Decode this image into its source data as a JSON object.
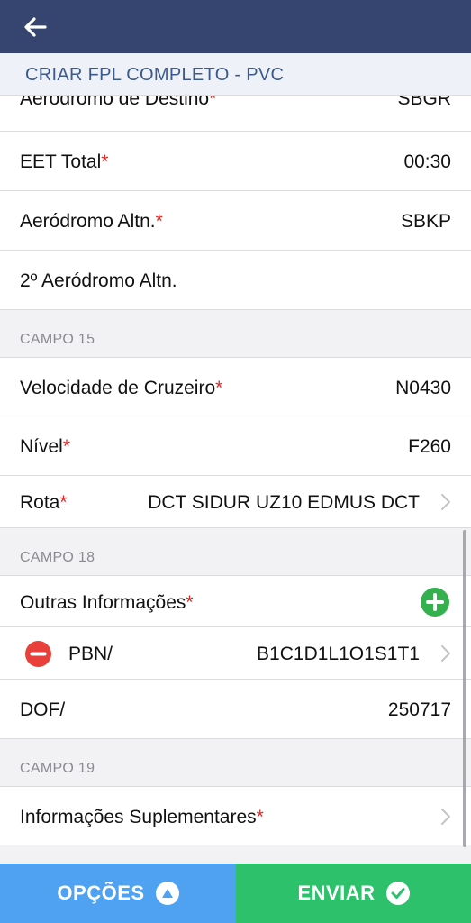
{
  "header": {
    "back_icon": "arrow-left-icon",
    "title": "CRIAR FPL COMPLETO - PVC"
  },
  "rows_top": [
    {
      "label": "Aeródromo de Destino",
      "required": "*",
      "value": "SBGR"
    },
    {
      "label": "EET Total",
      "required": "*",
      "value": "00:30"
    },
    {
      "label": "Aeródromo Altn.",
      "required": "*",
      "value": "SBKP"
    },
    {
      "label": "2º Aeródromo Altn.",
      "required": "",
      "value": ""
    }
  ],
  "campo15": {
    "title": "CAMPO 15",
    "velocidade": {
      "label": "Velocidade de Cruzeiro",
      "required": "*",
      "value": "N0430"
    },
    "nivel": {
      "label": "Nível",
      "required": "*",
      "value": "F260"
    },
    "rota": {
      "label": "Rota",
      "required": "*",
      "value": "DCT SIDUR UZ10 EDMUS DCT"
    }
  },
  "campo18": {
    "title": "CAMPO 18",
    "outras": {
      "label": "Outras Informações",
      "required": "*"
    },
    "pbn": {
      "label": "PBN/",
      "value": "B1C1D1L1O1S1T1"
    },
    "dof": {
      "label": "DOF/",
      "value": "250717"
    }
  },
  "campo19": {
    "title": "CAMPO 19",
    "suplementares": {
      "label": "Informações Suplementares",
      "required": "*"
    }
  },
  "footer": {
    "opcoes_label": "OPÇÕES",
    "enviar_label": "ENVIAR"
  },
  "colors": {
    "navbar": "#36456f",
    "required": "#e02525",
    "add": "#34b04f",
    "remove": "#e8403a",
    "opcoes": "#4fa1f2",
    "enviar": "#2cc16a"
  }
}
